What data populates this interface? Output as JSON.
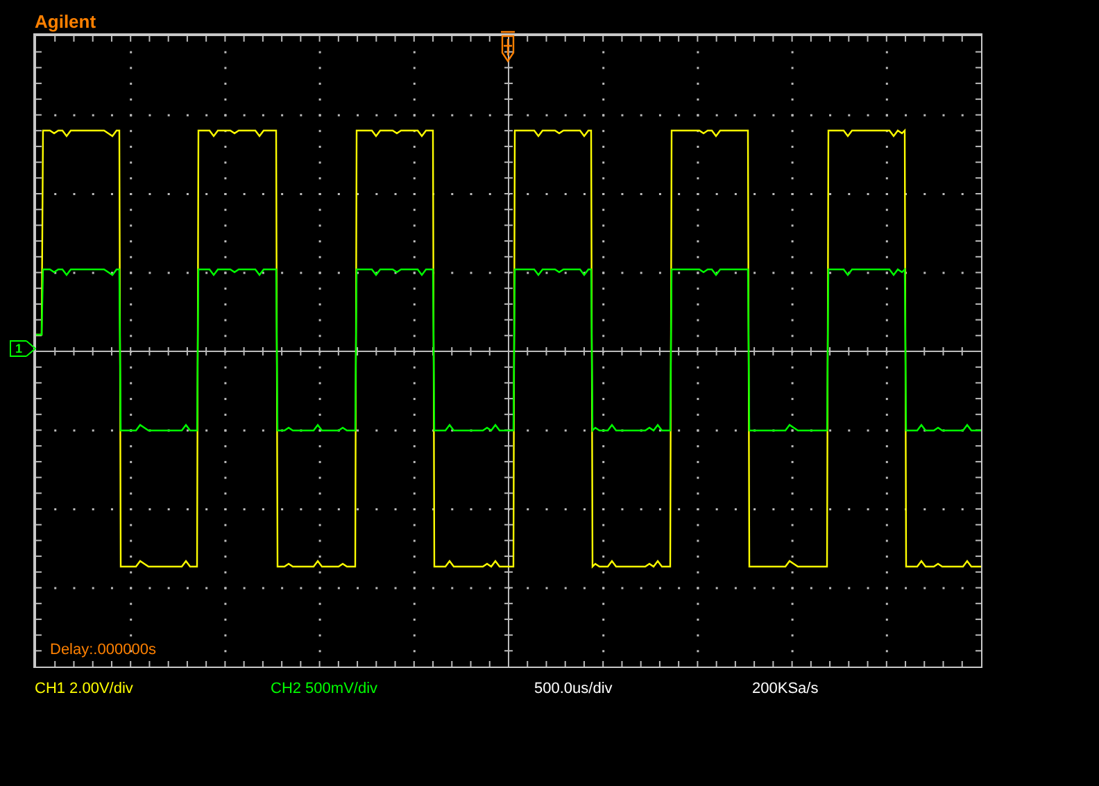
{
  "brand": "Agilent",
  "screen": {
    "channel_marker": "1",
    "delay": "Delay:.000000s"
  },
  "status": [
    {
      "text": "CH1 2.00V/div",
      "color": "#ffff00"
    },
    {
      "text": "CH2 500mV/div",
      "color": "#00ff00"
    },
    {
      "text": "500.0us/div",
      "color": "#ffffff"
    },
    {
      "text": "200KSa/s",
      "color": "#ffffff"
    }
  ]
}
